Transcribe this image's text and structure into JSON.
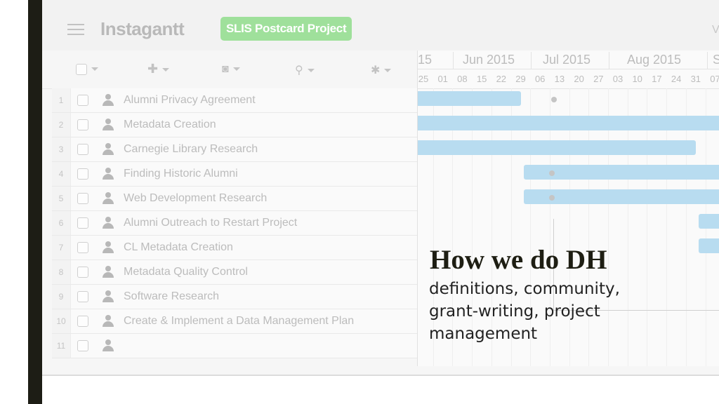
{
  "app": {
    "title": "Instagantt",
    "project_badge": "SLIS Postcard Project",
    "topbar_right_char": "V"
  },
  "toolbar": {
    "icons": [
      "select-checkbox",
      "add-plus",
      "camera",
      "zoom-magnifier",
      "settings-gear"
    ],
    "add_glyph": "✚",
    "camera_glyph": "◙",
    "zoom_glyph": "⚲",
    "gear_glyph": "✱"
  },
  "tasks": [
    {
      "num": "1",
      "name": "Alumni Privacy Agreement"
    },
    {
      "num": "2",
      "name": "Metadata Creation"
    },
    {
      "num": "3",
      "name": "Carnegie Library Research"
    },
    {
      "num": "4",
      "name": "Finding Historic Alumni"
    },
    {
      "num": "5",
      "name": "Web Development Research"
    },
    {
      "num": "6",
      "name": "Alumni Outreach to Restart Project"
    },
    {
      "num": "7",
      "name": "CL Metadata Creation"
    },
    {
      "num": "8",
      "name": "Metadata Quality Control"
    },
    {
      "num": "9",
      "name": "Software Research"
    },
    {
      "num": "10",
      "name": "Create & Implement a Data Management Plan"
    },
    {
      "num": "11",
      "name": ""
    }
  ],
  "timeline": {
    "months": [
      "15",
      "Jun 2015",
      "Jul 2015",
      "Aug 2015",
      "S"
    ],
    "weeks": [
      "25",
      "01",
      "08",
      "15",
      "22",
      "29",
      "06",
      "13",
      "20",
      "27",
      "03",
      "10",
      "17",
      "24",
      "31",
      "07"
    ]
  },
  "gantt_bars": [
    {
      "task": 1,
      "start_week": "25 May",
      "end_week": "29 Jun"
    },
    {
      "task": 2,
      "start_week": "25 May",
      "end_week": "after 07 Sep"
    },
    {
      "task": 3,
      "start_week": "25 May",
      "end_week": "31 Aug"
    },
    {
      "task": 4,
      "start_week": "29 Jun",
      "end_week": "after 07 Sep"
    },
    {
      "task": 5,
      "start_week": "29 Jun",
      "end_week": "after 07 Sep"
    },
    {
      "task": 6,
      "start_week": "31 Aug",
      "end_week": "after 07 Sep"
    },
    {
      "task": 7,
      "start_week": "31 Aug",
      "end_week": "after 07 Sep"
    }
  ],
  "colors": {
    "bar": "#b8dcf0",
    "badge": "#9fe09b",
    "overlay_text": "#1e1e13"
  },
  "overlay": {
    "title": "How we do DH",
    "subtitle": "definitions, community, grant-writing, project management"
  }
}
